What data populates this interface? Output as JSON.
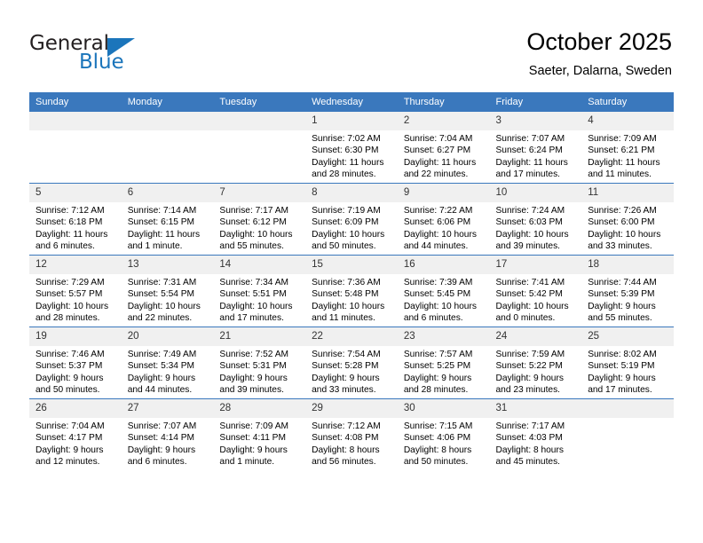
{
  "brand": {
    "word_one": "General",
    "word_two": "Blue",
    "flag_icon": "triangle-flag-icon",
    "color_primary": "#1b75bb",
    "color_text": "#231f20"
  },
  "header": {
    "title": "October 2025",
    "subtitle": "Saeter, Dalarna, Sweden"
  },
  "theme": {
    "header_row_bg": "#3a78bd",
    "daynum_bg": "#f0f0f0",
    "grid_line": "#3a78bd",
    "page_bg": "#ffffff"
  },
  "weekday_headers": [
    "Sunday",
    "Monday",
    "Tuesday",
    "Wednesday",
    "Thursday",
    "Friday",
    "Saturday"
  ],
  "labels": {
    "sunrise_prefix": "Sunrise:",
    "sunset_prefix": "Sunset:",
    "daylight_prefix": "Daylight:"
  },
  "weeks": [
    [
      {
        "day": "",
        "empty": true,
        "sunrise": "",
        "sunset": "",
        "daylight": ""
      },
      {
        "day": "",
        "empty": true,
        "sunrise": "",
        "sunset": "",
        "daylight": ""
      },
      {
        "day": "",
        "empty": true,
        "sunrise": "",
        "sunset": "",
        "daylight": ""
      },
      {
        "day": "1",
        "empty": false,
        "sunrise": "Sunrise: 7:02 AM",
        "sunset": "Sunset: 6:30 PM",
        "daylight": "Daylight: 11 hours and 28 minutes."
      },
      {
        "day": "2",
        "empty": false,
        "sunrise": "Sunrise: 7:04 AM",
        "sunset": "Sunset: 6:27 PM",
        "daylight": "Daylight: 11 hours and 22 minutes."
      },
      {
        "day": "3",
        "empty": false,
        "sunrise": "Sunrise: 7:07 AM",
        "sunset": "Sunset: 6:24 PM",
        "daylight": "Daylight: 11 hours and 17 minutes."
      },
      {
        "day": "4",
        "empty": false,
        "sunrise": "Sunrise: 7:09 AM",
        "sunset": "Sunset: 6:21 PM",
        "daylight": "Daylight: 11 hours and 11 minutes."
      }
    ],
    [
      {
        "day": "5",
        "empty": false,
        "sunrise": "Sunrise: 7:12 AM",
        "sunset": "Sunset: 6:18 PM",
        "daylight": "Daylight: 11 hours and 6 minutes."
      },
      {
        "day": "6",
        "empty": false,
        "sunrise": "Sunrise: 7:14 AM",
        "sunset": "Sunset: 6:15 PM",
        "daylight": "Daylight: 11 hours and 1 minute."
      },
      {
        "day": "7",
        "empty": false,
        "sunrise": "Sunrise: 7:17 AM",
        "sunset": "Sunset: 6:12 PM",
        "daylight": "Daylight: 10 hours and 55 minutes."
      },
      {
        "day": "8",
        "empty": false,
        "sunrise": "Sunrise: 7:19 AM",
        "sunset": "Sunset: 6:09 PM",
        "daylight": "Daylight: 10 hours and 50 minutes."
      },
      {
        "day": "9",
        "empty": false,
        "sunrise": "Sunrise: 7:22 AM",
        "sunset": "Sunset: 6:06 PM",
        "daylight": "Daylight: 10 hours and 44 minutes."
      },
      {
        "day": "10",
        "empty": false,
        "sunrise": "Sunrise: 7:24 AM",
        "sunset": "Sunset: 6:03 PM",
        "daylight": "Daylight: 10 hours and 39 minutes."
      },
      {
        "day": "11",
        "empty": false,
        "sunrise": "Sunrise: 7:26 AM",
        "sunset": "Sunset: 6:00 PM",
        "daylight": "Daylight: 10 hours and 33 minutes."
      }
    ],
    [
      {
        "day": "12",
        "empty": false,
        "sunrise": "Sunrise: 7:29 AM",
        "sunset": "Sunset: 5:57 PM",
        "daylight": "Daylight: 10 hours and 28 minutes."
      },
      {
        "day": "13",
        "empty": false,
        "sunrise": "Sunrise: 7:31 AM",
        "sunset": "Sunset: 5:54 PM",
        "daylight": "Daylight: 10 hours and 22 minutes."
      },
      {
        "day": "14",
        "empty": false,
        "sunrise": "Sunrise: 7:34 AM",
        "sunset": "Sunset: 5:51 PM",
        "daylight": "Daylight: 10 hours and 17 minutes."
      },
      {
        "day": "15",
        "empty": false,
        "sunrise": "Sunrise: 7:36 AM",
        "sunset": "Sunset: 5:48 PM",
        "daylight": "Daylight: 10 hours and 11 minutes."
      },
      {
        "day": "16",
        "empty": false,
        "sunrise": "Sunrise: 7:39 AM",
        "sunset": "Sunset: 5:45 PM",
        "daylight": "Daylight: 10 hours and 6 minutes."
      },
      {
        "day": "17",
        "empty": false,
        "sunrise": "Sunrise: 7:41 AM",
        "sunset": "Sunset: 5:42 PM",
        "daylight": "Daylight: 10 hours and 0 minutes."
      },
      {
        "day": "18",
        "empty": false,
        "sunrise": "Sunrise: 7:44 AM",
        "sunset": "Sunset: 5:39 PM",
        "daylight": "Daylight: 9 hours and 55 minutes."
      }
    ],
    [
      {
        "day": "19",
        "empty": false,
        "sunrise": "Sunrise: 7:46 AM",
        "sunset": "Sunset: 5:37 PM",
        "daylight": "Daylight: 9 hours and 50 minutes."
      },
      {
        "day": "20",
        "empty": false,
        "sunrise": "Sunrise: 7:49 AM",
        "sunset": "Sunset: 5:34 PM",
        "daylight": "Daylight: 9 hours and 44 minutes."
      },
      {
        "day": "21",
        "empty": false,
        "sunrise": "Sunrise: 7:52 AM",
        "sunset": "Sunset: 5:31 PM",
        "daylight": "Daylight: 9 hours and 39 minutes."
      },
      {
        "day": "22",
        "empty": false,
        "sunrise": "Sunrise: 7:54 AM",
        "sunset": "Sunset: 5:28 PM",
        "daylight": "Daylight: 9 hours and 33 minutes."
      },
      {
        "day": "23",
        "empty": false,
        "sunrise": "Sunrise: 7:57 AM",
        "sunset": "Sunset: 5:25 PM",
        "daylight": "Daylight: 9 hours and 28 minutes."
      },
      {
        "day": "24",
        "empty": false,
        "sunrise": "Sunrise: 7:59 AM",
        "sunset": "Sunset: 5:22 PM",
        "daylight": "Daylight: 9 hours and 23 minutes."
      },
      {
        "day": "25",
        "empty": false,
        "sunrise": "Sunrise: 8:02 AM",
        "sunset": "Sunset: 5:19 PM",
        "daylight": "Daylight: 9 hours and 17 minutes."
      }
    ],
    [
      {
        "day": "26",
        "empty": false,
        "sunrise": "Sunrise: 7:04 AM",
        "sunset": "Sunset: 4:17 PM",
        "daylight": "Daylight: 9 hours and 12 minutes."
      },
      {
        "day": "27",
        "empty": false,
        "sunrise": "Sunrise: 7:07 AM",
        "sunset": "Sunset: 4:14 PM",
        "daylight": "Daylight: 9 hours and 6 minutes."
      },
      {
        "day": "28",
        "empty": false,
        "sunrise": "Sunrise: 7:09 AM",
        "sunset": "Sunset: 4:11 PM",
        "daylight": "Daylight: 9 hours and 1 minute."
      },
      {
        "day": "29",
        "empty": false,
        "sunrise": "Sunrise: 7:12 AM",
        "sunset": "Sunset: 4:08 PM",
        "daylight": "Daylight: 8 hours and 56 minutes."
      },
      {
        "day": "30",
        "empty": false,
        "sunrise": "Sunrise: 7:15 AM",
        "sunset": "Sunset: 4:06 PM",
        "daylight": "Daylight: 8 hours and 50 minutes."
      },
      {
        "day": "31",
        "empty": false,
        "sunrise": "Sunrise: 7:17 AM",
        "sunset": "Sunset: 4:03 PM",
        "daylight": "Daylight: 8 hours and 45 minutes."
      },
      {
        "day": "",
        "empty": true,
        "sunrise": "",
        "sunset": "",
        "daylight": ""
      }
    ]
  ]
}
